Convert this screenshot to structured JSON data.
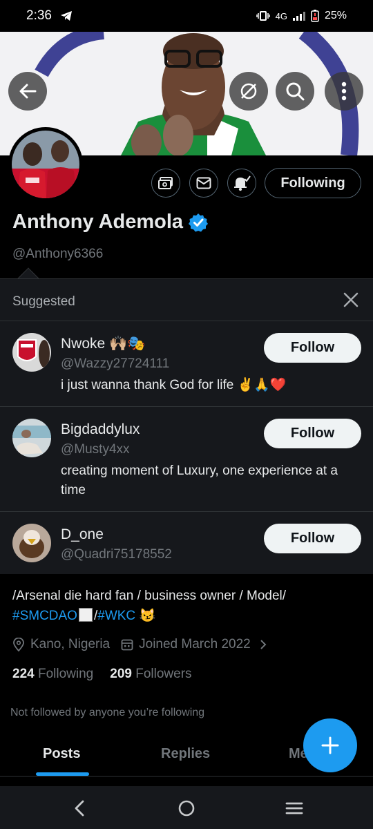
{
  "status_bar": {
    "time": "2:36",
    "network": "4G",
    "battery": "25%"
  },
  "profile": {
    "display_name": "Anthony Ademola",
    "handle": "@Anthony6366",
    "following_button": "Following",
    "bio_text": "/Arsenal die hard fan / business owner / Model/",
    "bio_tag_1": "#SMCDAO",
    "bio_separator": "/",
    "bio_tag_2": "#WKC",
    "location": "Kano, Nigeria",
    "joined": "Joined March 2022",
    "following_count": "224",
    "following_label": "Following",
    "followers_count": "209",
    "followers_label": "Followers",
    "not_followed_text": "Not followed by anyone you’re following"
  },
  "suggested": {
    "title": "Suggested",
    "follow_label": "Follow",
    "users": [
      {
        "name": "Nwoke 🙌🏼🎭",
        "handle": "@Wazzy27724111",
        "bio": "i just wanna thank God for life ✌️🙏❤️"
      },
      {
        "name": "Bigdaddylux",
        "handle": "@Musty4xx",
        "bio": "creating moment of Luxury, one experience at a time"
      },
      {
        "name": "D_one",
        "handle": "@Quadri75178552",
        "bio": ""
      }
    ]
  },
  "tabs": [
    "Posts",
    "Replies",
    "Me"
  ],
  "colors": {
    "accent": "#1d9bf0",
    "background": "#000000",
    "panel": "#16181c",
    "muted_text": "#71767b"
  }
}
